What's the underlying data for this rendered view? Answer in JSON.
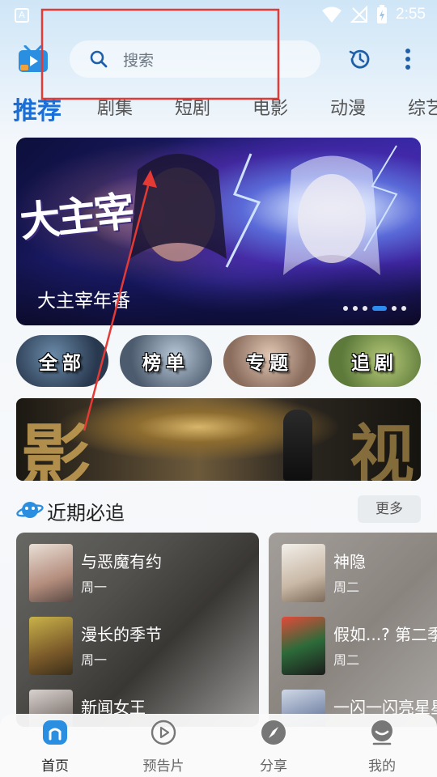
{
  "status_bar": {
    "app_badge": "A",
    "time": "2:55"
  },
  "header": {
    "search_placeholder": "搜索"
  },
  "tabs": [
    {
      "label": "推荐",
      "active": true
    },
    {
      "label": "剧集"
    },
    {
      "label": "短剧"
    },
    {
      "label": "电影"
    },
    {
      "label": "动漫"
    },
    {
      "label": "综艺"
    }
  ],
  "banner": {
    "title": "大主宰年番",
    "artwork_text": "大主宰",
    "slide_count": 6,
    "active_slide": 4
  },
  "quick_links": [
    {
      "label": "全部"
    },
    {
      "label": "榜单"
    },
    {
      "label": "专题"
    },
    {
      "label": "追剧"
    }
  ],
  "promo": {
    "text_left": "影",
    "text_right": "视"
  },
  "section": {
    "title": "近期必追",
    "more_label": "更多"
  },
  "cards": [
    {
      "items": [
        {
          "name": "与恶魔有约",
          "day": "周一"
        },
        {
          "name": "漫长的季节",
          "day": "周一"
        },
        {
          "name": "新闻女王",
          "day": "周一"
        }
      ]
    },
    {
      "items": [
        {
          "name": "神隐",
          "day": "周二"
        },
        {
          "name": "假如...? 第二季",
          "day": "周二"
        },
        {
          "name": "一闪一闪亮星星",
          "day": "周二"
        }
      ]
    }
  ],
  "bottom_nav": [
    {
      "label": "首页",
      "icon": "home-icon",
      "active": true
    },
    {
      "label": "预告片",
      "icon": "play-circle-icon"
    },
    {
      "label": "分享",
      "icon": "compass-icon"
    },
    {
      "label": "我的",
      "icon": "profile-icon"
    }
  ],
  "colors": {
    "accent": "#1a6fd6",
    "annotation": "#e53935"
  }
}
